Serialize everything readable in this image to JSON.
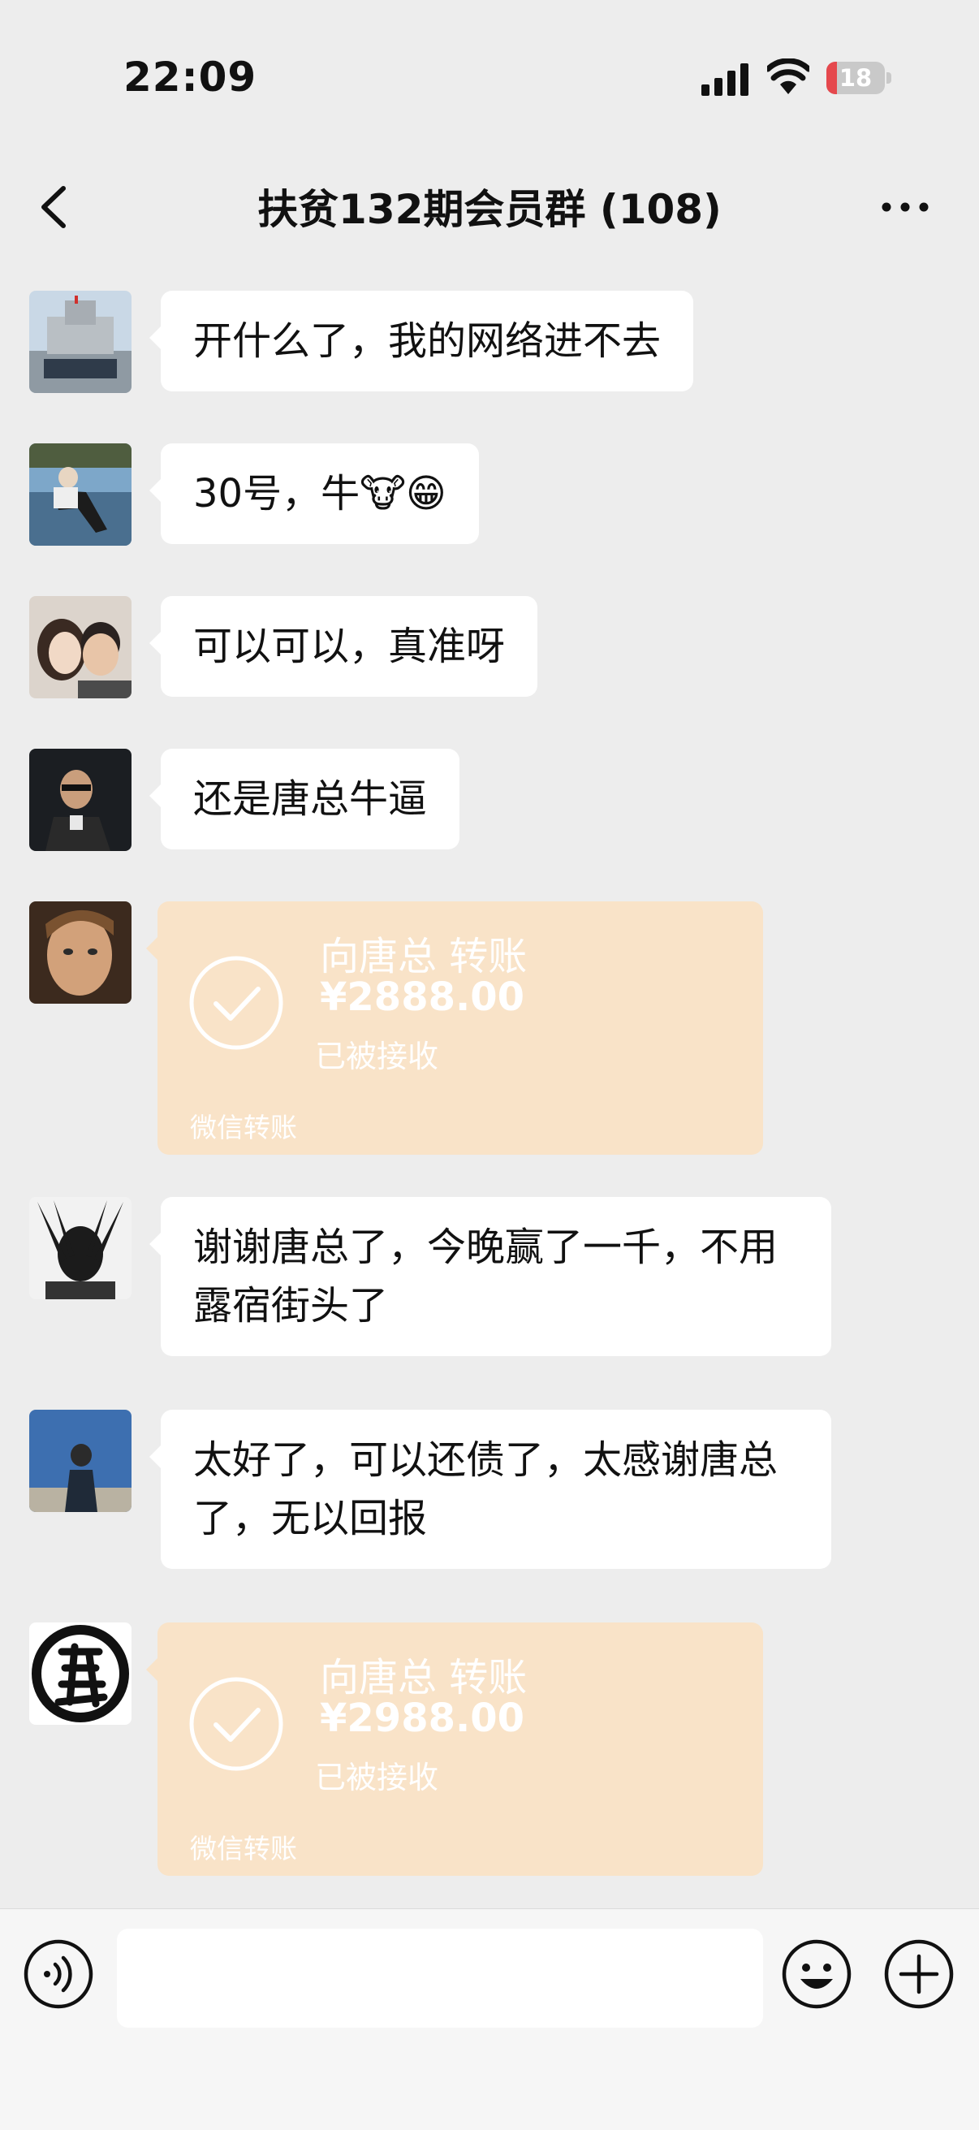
{
  "status_bar": {
    "time": "22:09",
    "battery": "18",
    "battery_level": 0.18
  },
  "header": {
    "title": "扶贫132期会员群 (108)"
  },
  "messages": [
    {
      "type": "text",
      "text": "开什么了，我的网络进不去"
    },
    {
      "type": "text",
      "text": "30号，牛🐮😁"
    },
    {
      "type": "text",
      "text": "可以可以，真准呀"
    },
    {
      "type": "text",
      "text": "还是唐总牛逼"
    },
    {
      "type": "transfer",
      "title": "向唐总 转账",
      "amount": "¥2888.00",
      "status": "已被接收",
      "footer": "微信转账"
    },
    {
      "type": "text",
      "text": "谢谢唐总了，今晚赢了一千，不用露宿街头了"
    },
    {
      "type": "text",
      "text": "太好了，可以还债了，太感谢唐总了，无以回报"
    },
    {
      "type": "transfer",
      "title": "向唐总 转账",
      "amount": "¥2988.00",
      "status": "已被接收",
      "footer": "微信转账"
    }
  ],
  "input_bar": {
    "value": ""
  },
  "colors": {
    "background": "#ededed",
    "transfer_card": "#f9e3c8",
    "battery_low": "#e5484d"
  }
}
